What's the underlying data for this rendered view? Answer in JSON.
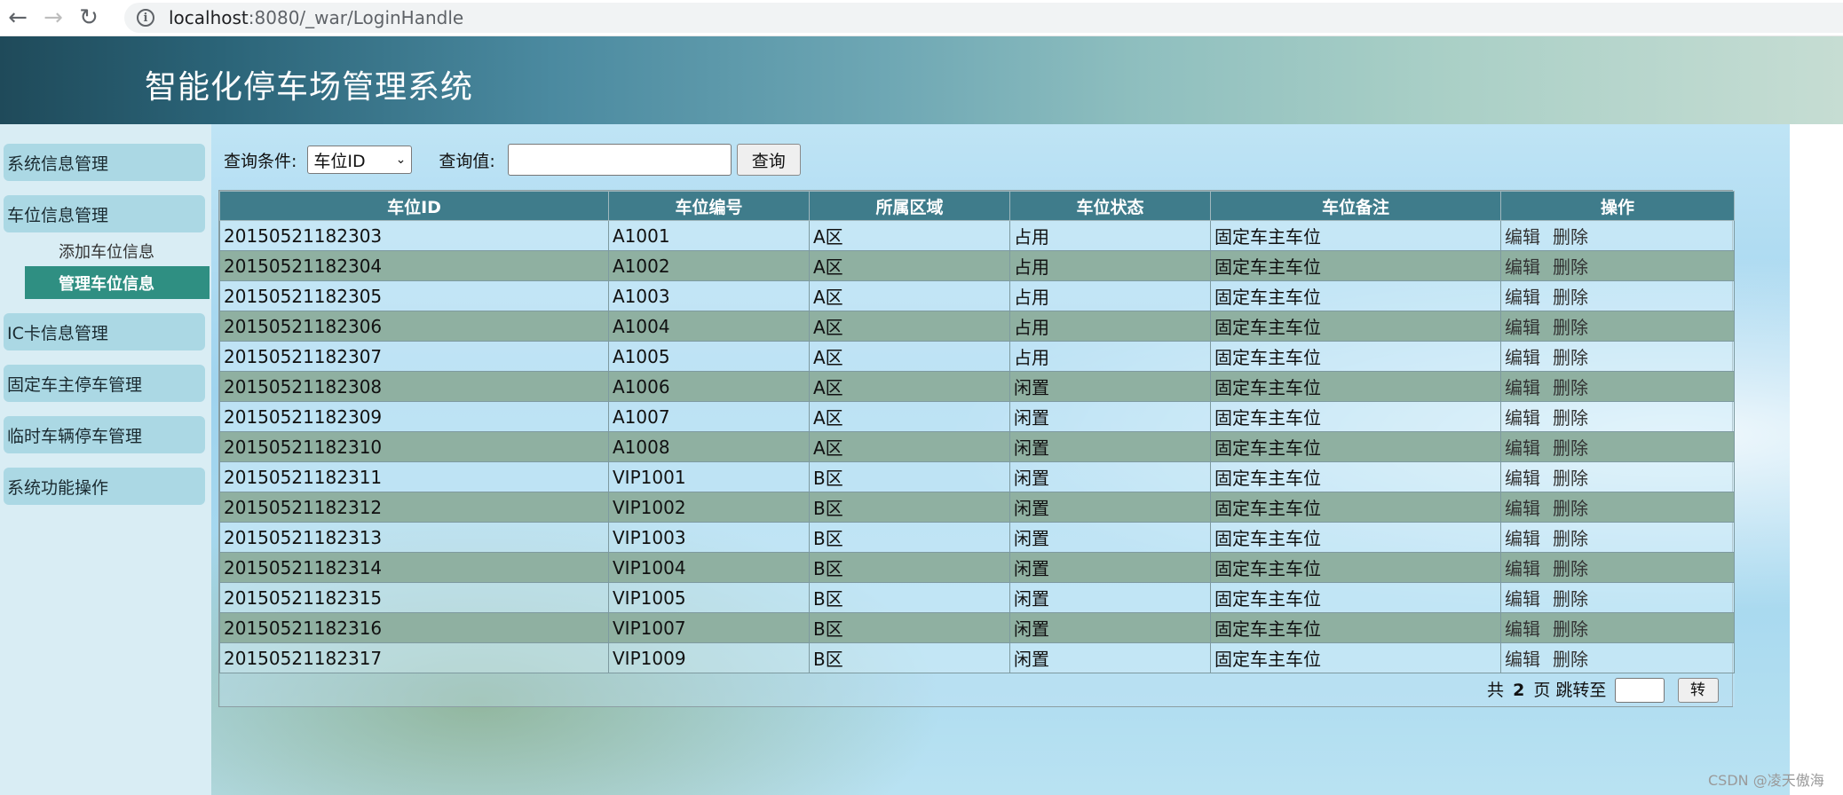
{
  "browser": {
    "url_host": "localhost",
    "url_path": ":8080/_war/LoginHandle"
  },
  "header": {
    "title": "智能化停车场管理系统"
  },
  "sidebar": {
    "items": [
      {
        "label": "系统信息管理"
      },
      {
        "label": "车位信息管理"
      },
      {
        "label": "IC卡信息管理"
      },
      {
        "label": "固定车主停车管理"
      },
      {
        "label": "临时车辆停车管理"
      },
      {
        "label": "系统功能操作"
      }
    ],
    "sub_items": [
      {
        "label": "添加车位信息"
      },
      {
        "label": "管理车位信息"
      }
    ]
  },
  "query": {
    "condition_label": "查询条件:",
    "condition_selected": "车位ID",
    "value_label": "查询值:",
    "value": "",
    "button_label": "查询"
  },
  "table": {
    "headers": [
      "车位ID",
      "车位编号",
      "所属区域",
      "车位状态",
      "车位备注",
      "操作"
    ],
    "edit_label": "编辑",
    "delete_label": "删除",
    "rows": [
      [
        "20150521182303",
        "A1001",
        "A区",
        "占用",
        "固定车主车位"
      ],
      [
        "20150521182304",
        "A1002",
        "A区",
        "占用",
        "固定车主车位"
      ],
      [
        "20150521182305",
        "A1003",
        "A区",
        "占用",
        "固定车主车位"
      ],
      [
        "20150521182306",
        "A1004",
        "A区",
        "占用",
        "固定车主车位"
      ],
      [
        "20150521182307",
        "A1005",
        "A区",
        "占用",
        "固定车主车位"
      ],
      [
        "20150521182308",
        "A1006",
        "A区",
        "闲置",
        "固定车主车位"
      ],
      [
        "20150521182309",
        "A1007",
        "A区",
        "闲置",
        "固定车主车位"
      ],
      [
        "20150521182310",
        "A1008",
        "A区",
        "闲置",
        "固定车主车位"
      ],
      [
        "20150521182311",
        "VIP1001",
        "B区",
        "闲置",
        "固定车主车位"
      ],
      [
        "20150521182312",
        "VIP1002",
        "B区",
        "闲置",
        "固定车主车位"
      ],
      [
        "20150521182313",
        "VIP1003",
        "B区",
        "闲置",
        "固定车主车位"
      ],
      [
        "20150521182314",
        "VIP1004",
        "B区",
        "闲置",
        "固定车主车位"
      ],
      [
        "20150521182315",
        "VIP1005",
        "B区",
        "闲置",
        "固定车主车位"
      ],
      [
        "20150521182316",
        "VIP1007",
        "B区",
        "闲置",
        "固定车主车位"
      ],
      [
        "20150521182317",
        "VIP1009",
        "B区",
        "闲置",
        "固定车主车位"
      ]
    ]
  },
  "pager": {
    "prefix": "共",
    "total_pages": "2",
    "suffix": "页 跳转至",
    "go_label": "转"
  },
  "watermark": "CSDN @凌天傲海"
}
